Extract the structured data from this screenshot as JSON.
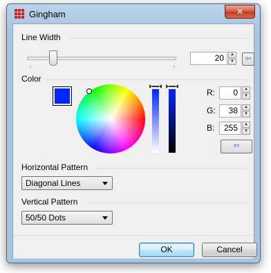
{
  "window": {
    "title": "Gingham",
    "close_glyph": "✕"
  },
  "line_width": {
    "label": "Line Width",
    "value": "20",
    "slider_level": 0.15
  },
  "color": {
    "label": "Color",
    "current_hex": "#0026ff",
    "r_label": "R:",
    "r": "0",
    "g_label": "G:",
    "g": "38",
    "b_label": "B:",
    "b": "255"
  },
  "horizontal_pattern": {
    "label": "Horizontal Pattern",
    "value": "Diagonal Lines"
  },
  "vertical_pattern": {
    "label": "Vertical Pattern",
    "value": "50/50 Dots"
  },
  "buttons": {
    "ok": "OK",
    "cancel": "Cancel",
    "apply_glyph": "⇦"
  },
  "icons": {
    "spin_up": "▲",
    "spin_down": "▼"
  }
}
